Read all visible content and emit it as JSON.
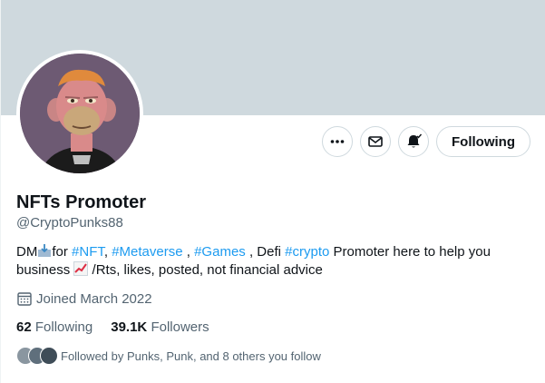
{
  "profile": {
    "display_name": "NFTs Promoter",
    "handle": "@CryptoPunks88",
    "bio": {
      "t1": "DM",
      "t2": "for ",
      "tag1": "#NFT",
      "t3": ", ",
      "tag2": "#Metaverse",
      "t4": " , ",
      "tag3": "#Games",
      "t5": " , Defi ",
      "tag4": "#crypto",
      "t6": " Promoter here to help you business ",
      "t7": " /Rts, likes, posted, not financial advice"
    },
    "joined": "Joined March 2022",
    "following_count": "62",
    "following_label": "Following",
    "followers_count": "39.1K",
    "followers_label": "Followers",
    "followed_by": "Followed by Punks, Punk, and 8 others you follow"
  },
  "actions": {
    "more_icon": "more-icon",
    "message_icon": "envelope-icon",
    "notify_icon": "bell-icon",
    "follow_label": "Following"
  },
  "colors": {
    "banner": "#cfd9de",
    "link": "#1d9bf0",
    "muted": "#536471",
    "avatar_bg": "#6d5a73"
  }
}
